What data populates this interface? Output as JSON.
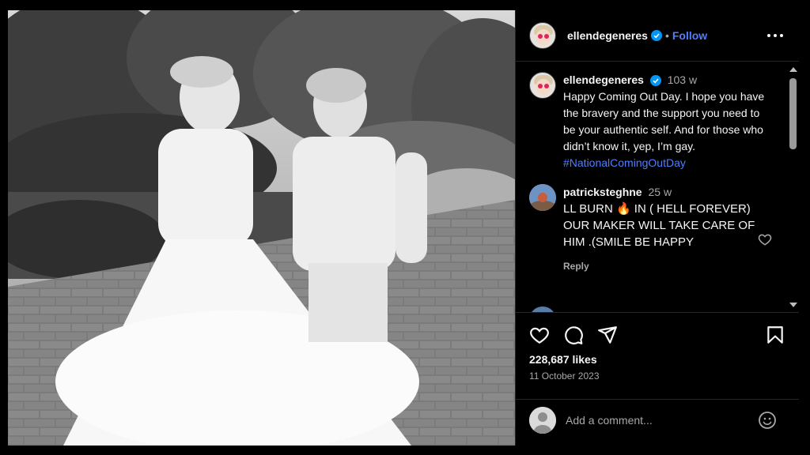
{
  "post": {
    "username": "ellendegeneres",
    "follow_label": "Follow",
    "separator": "•"
  },
  "caption": {
    "username": "ellendegeneres",
    "time": "103 w",
    "text": "Happy Coming Out Day. I hope you have the bravery and the support you need to be your authentic self. And for those who didn’t know it, yep, I’m gay.",
    "hashtag": "#NationalComingOutDay"
  },
  "comments": [
    {
      "username": "patricksteghne",
      "time": "25 w",
      "text": "LL BURN 🔥 IN ( HELL FOREVER) OUR MAKER WILL TAKE CARE OF HIM .(SMILE BE HAPPY",
      "reply_label": "Reply"
    }
  ],
  "stats": {
    "likes": "228,687 likes",
    "date": "11 October 2023"
  },
  "add_comment": {
    "placeholder": "Add a comment..."
  },
  "icons": {
    "more": "more-options-icon",
    "like": "heart-icon",
    "comment": "comment-icon",
    "share": "share-icon",
    "save": "bookmark-icon",
    "emoji": "emoji-icon",
    "verified": "verified-badge-icon"
  },
  "colors": {
    "accent": "#4f7fff",
    "background": "#000000",
    "muted": "#a8a8a8"
  }
}
